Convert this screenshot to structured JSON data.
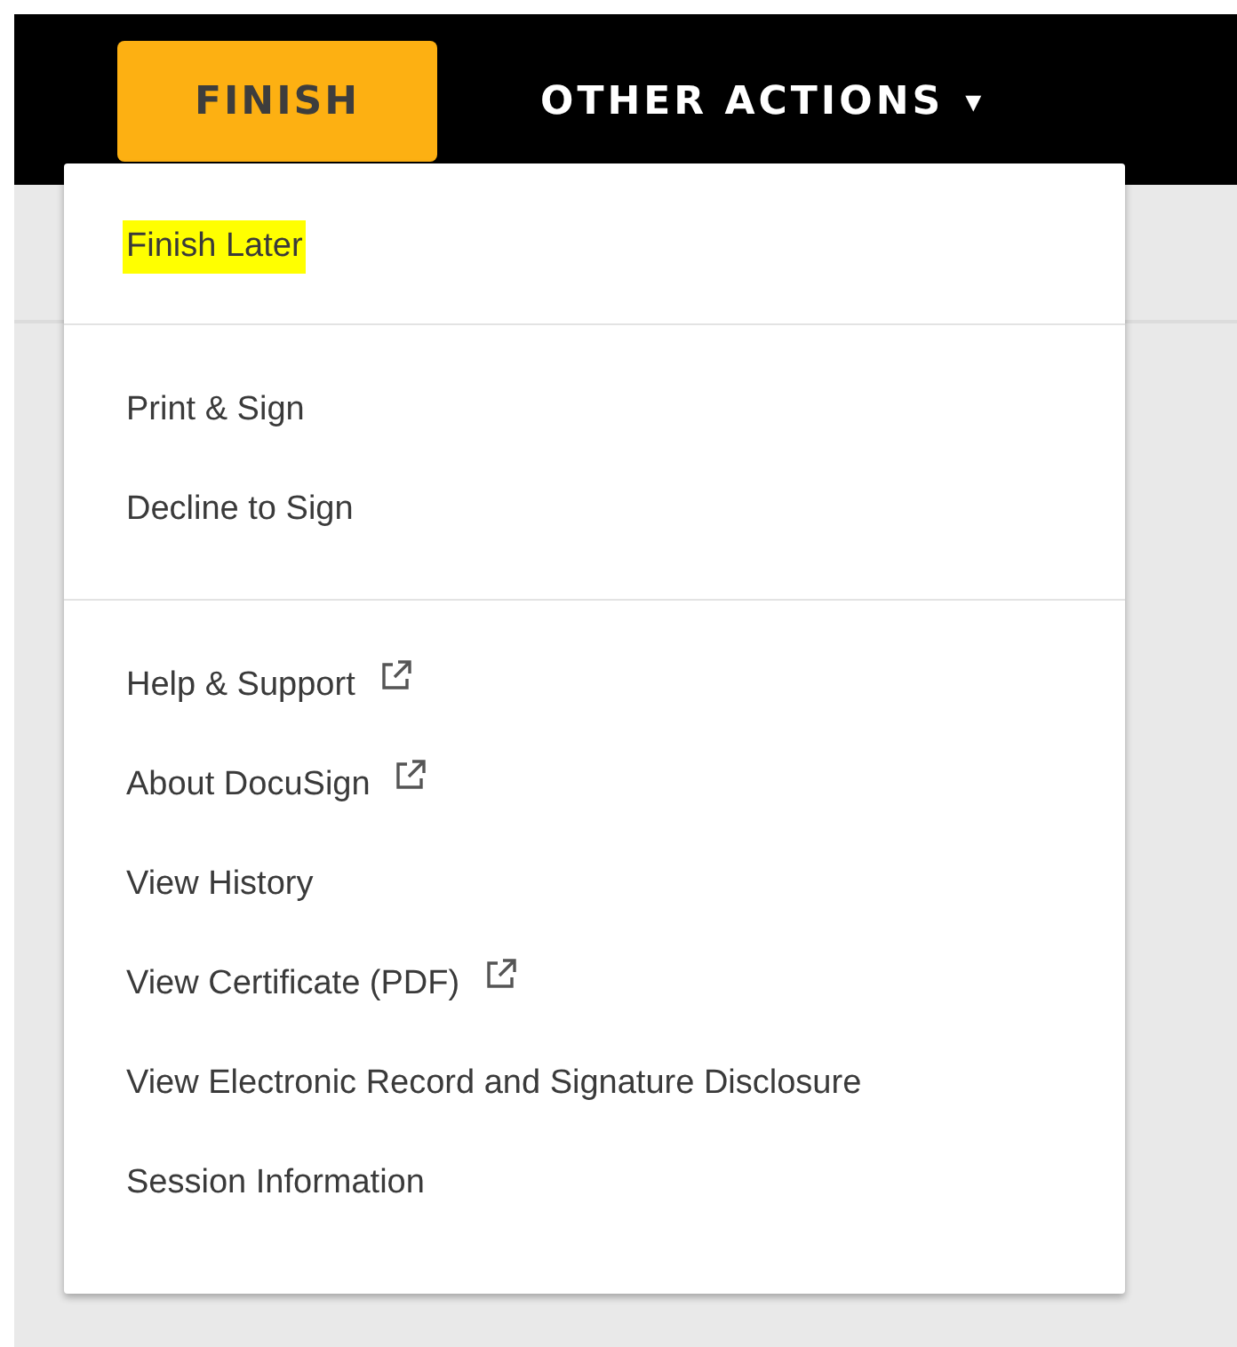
{
  "toolbar": {
    "finish_button": "FINISH",
    "other_actions": {
      "label": "OTHER ACTIONS",
      "caret": "▾"
    }
  },
  "menu": {
    "sections": [
      {
        "items": [
          {
            "label": "Finish Later",
            "highlighted": true,
            "external": false
          }
        ]
      },
      {
        "items": [
          {
            "label": "Print & Sign",
            "highlighted": false,
            "external": false
          },
          {
            "label": "Decline to Sign",
            "highlighted": false,
            "external": false
          }
        ]
      },
      {
        "items": [
          {
            "label": "Help & Support",
            "highlighted": false,
            "external": true
          },
          {
            "label": "About DocuSign",
            "highlighted": false,
            "external": true
          },
          {
            "label": "View History",
            "highlighted": false,
            "external": false
          },
          {
            "label": "View Certificate (PDF)",
            "highlighted": false,
            "external": true
          },
          {
            "label": "View Electronic Record and Signature Disclosure",
            "highlighted": false,
            "external": false
          },
          {
            "label": "Session Information",
            "highlighted": false,
            "external": false
          }
        ]
      }
    ]
  }
}
